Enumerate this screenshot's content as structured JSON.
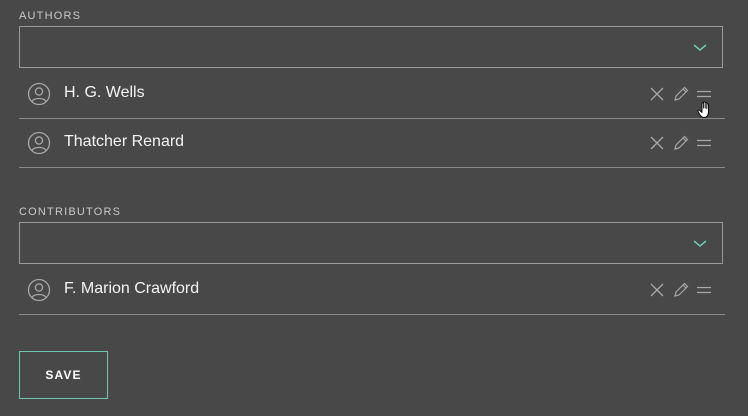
{
  "authors": {
    "label": "AUTHORS",
    "select_value": "",
    "items": [
      {
        "name": "H. G. Wells"
      },
      {
        "name": "Thatcher Renard"
      }
    ]
  },
  "contributors": {
    "label": "CONTRIBUTORS",
    "select_value": "",
    "items": [
      {
        "name": "F. Marion Crawford"
      }
    ]
  },
  "save_label": "SAVE",
  "colors": {
    "background": "#484848",
    "accent": "#6fc7b1",
    "border": "#9a9a9a",
    "icon": "#a8a8a8"
  },
  "icons": {
    "avatar": "user-avatar-icon",
    "remove": "close-icon",
    "edit": "pencil-icon",
    "drag": "drag-handle-icon",
    "dropdown": "chevron-down-icon",
    "cursor": "hand-cursor-icon"
  }
}
